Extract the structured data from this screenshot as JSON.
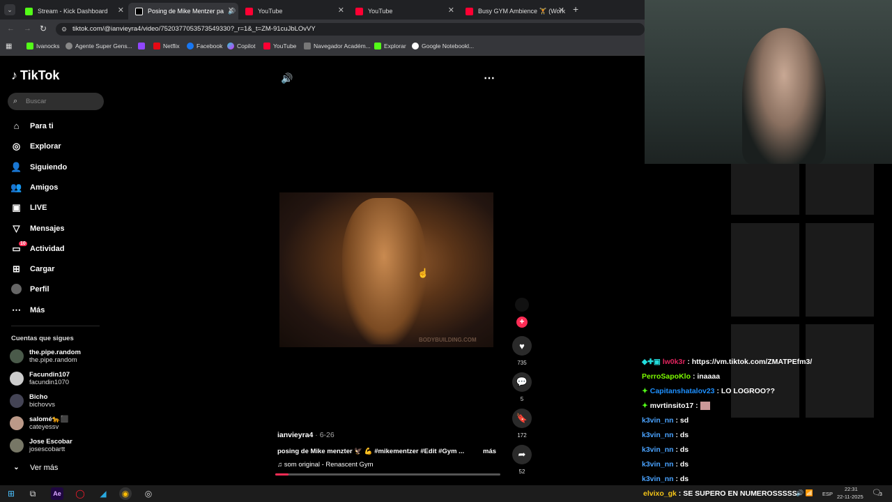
{
  "tabs": [
    {
      "label": "Stream - Kick Dashboard",
      "icon": "kick-icon",
      "color": "#53fc18"
    },
    {
      "label": "Posing de Mike Mentzer pa",
      "icon": "tiktok-icon",
      "color": "#ffffff"
    },
    {
      "label": "YouTube",
      "icon": "youtube-icon",
      "color": "#ff0033"
    },
    {
      "label": "YouTube",
      "icon": "youtube-icon",
      "color": "#ff0033"
    },
    {
      "label": "Busy GYM Ambience 🏋 (Work",
      "icon": "youtube-icon",
      "color": "#ff0033"
    }
  ],
  "url": "tiktok.com/@ianvieyra4/video/7520377053573549330?_r=1&_t=ZM-91cuJbLOvVY",
  "bookmarks": [
    "Ivanocks",
    "Agente Super Gens...",
    "",
    "Netflix",
    "Facebook",
    "Copilot",
    "YouTube",
    "Navegador Académ...",
    "Explorar",
    "Google Notebookl..."
  ],
  "tiktok": {
    "logo": "TikTok",
    "search_placeholder": "Buscar",
    "nav": [
      "Para ti",
      "Explorar",
      "Siguiendo",
      "Amigos",
      "LIVE",
      "Mensajes",
      "Actividad",
      "Cargar",
      "Perfil",
      "Más"
    ],
    "activity_badge": "10",
    "following_title": "Cuentas que sigues",
    "accounts": [
      {
        "name": "the.pipe.random",
        "user": "the.pipe.random"
      },
      {
        "name": "Facundin107",
        "user": "facundin1070"
      },
      {
        "name": "Bicho",
        "user": "bichovvs"
      },
      {
        "name": "salomé🐆⬛",
        "user": "cateyessv"
      },
      {
        "name": "Jose Escobar",
        "user": "josescobartt"
      }
    ],
    "see_more": "Ver más"
  },
  "video": {
    "author": "ianvieyra4",
    "date": "6-26",
    "caption": "posing de Mike menzter 🦅 💪 #mikementzer #Edit #Gym ...",
    "more": "más",
    "sound": "som original - Renascent Gym",
    "watermark": "BODYBUILDING.COM",
    "likes": "735",
    "comments": "5",
    "saves": "172",
    "shares": "52",
    "progress": 0.06
  },
  "chat": [
    {
      "user": "lw0k3r",
      "text": ": https://vm.tiktok.com/ZMATPEfm3/",
      "color": "#e0245e"
    },
    {
      "user": "PerroSapoKlo",
      "text": ": inaaaa",
      "color": "#7cfc00"
    },
    {
      "user": "Capitanshatalov23",
      "text": ": LO LOGROO??",
      "color": "#1e90ff"
    },
    {
      "user": "mvrtinsito17",
      "text": ":",
      "color": "#ffffff"
    },
    {
      "user": "k3vin_nn",
      "text": ": sd",
      "color": "#4aa3ff"
    },
    {
      "user": "k3vin_nn",
      "text": ": ds",
      "color": "#4aa3ff"
    },
    {
      "user": "k3vin_nn",
      "text": ": ds",
      "color": "#4aa3ff"
    },
    {
      "user": "k3vin_nn",
      "text": ": ds",
      "color": "#4aa3ff"
    },
    {
      "user": "k3vin_nn",
      "text": ": ds",
      "color": "#4aa3ff"
    },
    {
      "user": "elvixo_gk",
      "text": ": SE SUPERO EN NUMEROSSSSS",
      "color": "#f5c518"
    }
  ],
  "taskbar": {
    "lang": "ESP",
    "time": "22:31",
    "date": "22-11-2025",
    "notif": "3"
  }
}
